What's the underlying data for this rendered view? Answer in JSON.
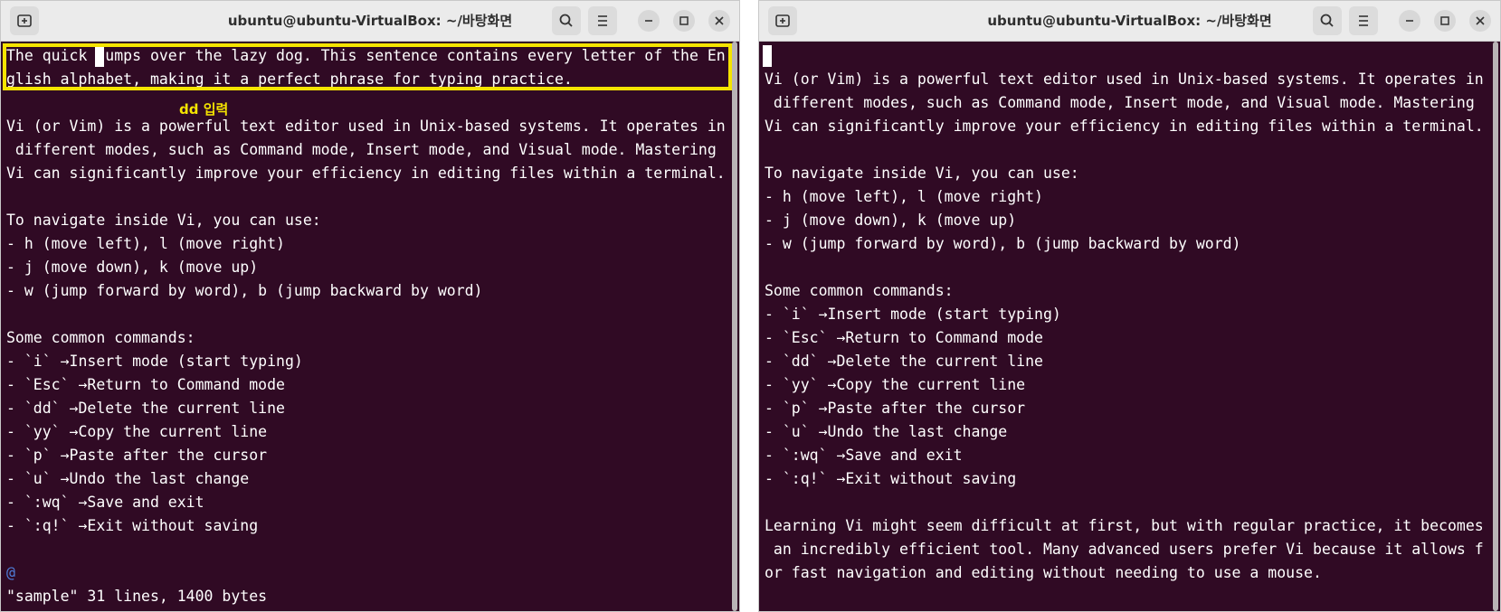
{
  "left_window": {
    "title": "ubuntu@ubuntu-VirtualBox: ~/바탕화면",
    "annotation": "dd 입력",
    "lines": [
      "The quick jumps over the lazy dog. This sentence contains every letter of the En",
      "glish alphabet, making it a perfect phrase for typing practice.",
      "",
      "Vi (or Vim) is a powerful text editor used in Unix-based systems. It operates in",
      " different modes, such as Command mode, Insert mode, and Visual mode. Mastering",
      "Vi can significantly improve your efficiency in editing files within a terminal.",
      "",
      "To navigate inside Vi, you can use:",
      "- h (move left), l (move right)",
      "- j (move down), k (move up)",
      "- w (jump forward by word), b (jump backward by word)",
      "",
      "Some common commands:",
      "- `i` →Insert mode (start typing)",
      "- `Esc` →Return to Command mode",
      "- `dd` →Delete the current line",
      "- `yy` →Copy the current line",
      "- `p` →Paste after the cursor",
      "- `u` →Undo the last change",
      "- `:wq` →Save and exit",
      "- `:q!` →Exit without saving",
      "",
      "@",
      "\"sample\" 31 lines, 1400 bytes"
    ]
  },
  "right_window": {
    "title": "ubuntu@ubuntu-VirtualBox: ~/바탕화면",
    "lines": [
      "",
      "Vi (or Vim) is a powerful text editor used in Unix-based systems. It operates in",
      " different modes, such as Command mode, Insert mode, and Visual mode. Mastering",
      "Vi can significantly improve your efficiency in editing files within a terminal.",
      "",
      "To navigate inside Vi, you can use:",
      "- h (move left), l (move right)",
      "- j (move down), k (move up)",
      "- w (jump forward by word), b (jump backward by word)",
      "",
      "Some common commands:",
      "- `i` →Insert mode (start typing)",
      "- `Esc` →Return to Command mode",
      "- `dd` →Delete the current line",
      "- `yy` →Copy the current line",
      "- `p` →Paste after the cursor",
      "- `u` →Undo the last change",
      "- `:wq` →Save and exit",
      "- `:q!` →Exit without saving",
      "",
      "Learning Vi might seem difficult at first, but with regular practice, it becomes",
      " an incredibly efficient tool. Many advanced users prefer Vi because it allows f",
      "or fast navigation and editing without needing to use a mouse."
    ]
  },
  "icons": {
    "new_tab": "new-tab-icon",
    "search": "search-icon",
    "menu": "hamburger-menu-icon",
    "minimize": "minimize-icon",
    "maximize": "maximize-icon",
    "close": "close-icon"
  },
  "colors": {
    "terminal_bg": "#300a24",
    "terminal_fg": "#ffffff",
    "highlight": "#f5e400",
    "tilde": "#4f7dd8"
  }
}
